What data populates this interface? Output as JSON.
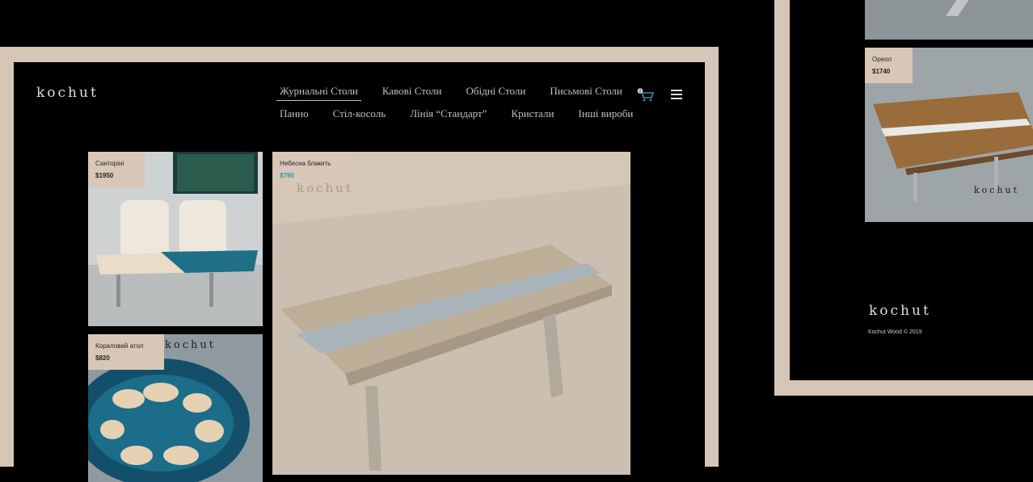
{
  "brand": {
    "logo": "kochut"
  },
  "nav": {
    "row1": [
      "Журнальні Столи",
      "Кавові Столи",
      "Обідні Столи",
      "Письмові Столи"
    ],
    "row2": [
      "Панно",
      "Стіл-косоль",
      "Лінія “Стандарт”",
      "Кристали",
      "Інші вироби"
    ],
    "active": "Журнальні Столи"
  },
  "cart": {
    "count": "0"
  },
  "products": [
    {
      "name": "Санторіні",
      "price": "$1950"
    },
    {
      "name": "Небесна блакить",
      "price": "$790"
    },
    {
      "name": "Кораловий атол",
      "price": "$820"
    },
    {
      "name": "Ореол",
      "price": "$1740"
    }
  ],
  "footer": {
    "copyright": "Kochut Wood © 2019"
  },
  "colors": {
    "frame": "#d5c6b8",
    "tag": "#d8c7b7",
    "accent": "#3f8fa3"
  }
}
